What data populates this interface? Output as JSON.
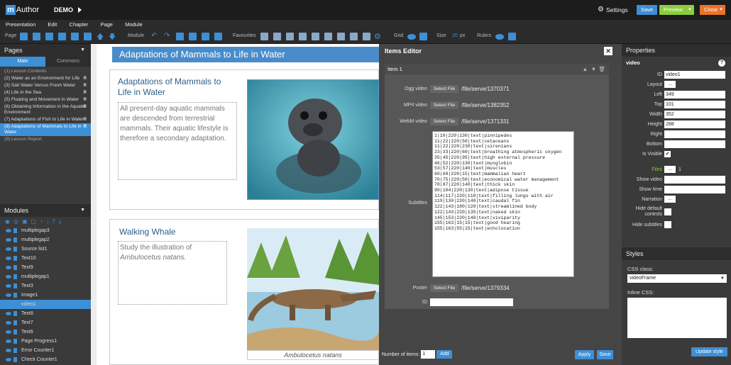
{
  "topbar": {
    "logo_m": "m",
    "logo_rest": "Author",
    "project": "DEMO",
    "settings": "Settings",
    "save": "Save",
    "preview": "Preview",
    "close": "Close"
  },
  "menu": [
    "Presentation",
    "Edit",
    "Chapter",
    "Page",
    "Module"
  ],
  "toolbar": {
    "page": "Page",
    "module": "Module",
    "favourites": "Favourites",
    "grid": "Grid",
    "size": "Size",
    "size_value": "20",
    "size_unit": "px",
    "rulers": "Rulers"
  },
  "pages": {
    "title": "Pages",
    "tab_main": "Main",
    "tab_commons": "Commons",
    "items": [
      {
        "label": "(1) Lesson Contents",
        "r": ""
      },
      {
        "label": "(2) Water as an Environment for Life",
        "r": "R"
      },
      {
        "label": "(3) Salt Water Versus Fresh Water",
        "r": "R"
      },
      {
        "label": "(4) Life in the Sea",
        "r": "R"
      },
      {
        "label": "(5) Floating and Movement in Water",
        "r": "R"
      },
      {
        "label": "(6) Obtaining Information in the Aquatic Environment",
        "r": "R"
      },
      {
        "label": "(7) Adaptations of Fish to Life in Water",
        "r": "R"
      },
      {
        "label": "(8) Adaptations of Mammals to Life in Water",
        "r": "R"
      },
      {
        "label": "(9) Lesson Report",
        "r": ""
      }
    ]
  },
  "modules": {
    "title": "Modules",
    "items": [
      "multiplegap3",
      "multiplegap2",
      "Source list1",
      "Text10",
      "Text9",
      "multiplegap1",
      "Text3",
      "Image1",
      "video1",
      "Text8",
      "Text7",
      "Text6",
      "Page Progress1",
      "Error Counter1",
      "Check Counter1"
    ]
  },
  "page": {
    "banner": "Adaptations of Mammals to Life in Water",
    "heading1": "Adaptations of Mammals to Life in Water",
    "text1": "All present-day aquatic mammals are descended from terrestrial mammals. Their aquatic lifestyle is therefore a secondary adaptation.",
    "heading2": "Walking Whale",
    "text2a": "Study the illustration of",
    "text2b": "Ambulocetus natans.",
    "caption": "Ambulocetus natans"
  },
  "items_editor": {
    "title": "Items Editor",
    "item": "Item 1",
    "ogg_label": "Ogg video",
    "ogg_path": "/file/serve/1370371",
    "mp4_label": "MP4 video",
    "mp4_path": "/file/serve/1382352",
    "webm_label": "WebM video",
    "webm_path": "/file/serve/1371331",
    "select_file": "Select File",
    "subtitles_label": "Subtitles",
    "subtitles": "1|10|220|130|text|pinnipedes\n11|22|220|50|text|cetaceans\n11|22|220|230|text|sirenians\n23|33|220|60|text|breathing atmospheric oxygen\n35|45|220|95|text|high external pressure\n46|52|220|130|text|myoglobin\n53|57|220|140|text|muscles\n60|68|220|15|text|mammalian heart\n70|75|220|50|text|economical water management\n78|87|220|140|text|thick skin\n90|104|220|130|text|adipose tissue\n114|117|220|110|text|filling lungs with air\n119|130|220|140|text|caudal fin\n122|143|180|120|text|streamlined body\n122|143|220|135|text|naked skin\n145|153|220|140|text|viviparity\n155|163|15|15|text|good hearing\n155|163|55|15|text|echolocation",
    "poster_label": "Poster",
    "poster_path": "/file/serve/1379334",
    "id_label": "ID",
    "id_value": "",
    "num_items_label": "Number of items:",
    "num_items": "1",
    "add": "Add",
    "apply": "Apply",
    "save": "Save"
  },
  "properties": {
    "title": "Properties",
    "section": "video",
    "rows": [
      {
        "k": "ID",
        "v": "video1"
      },
      {
        "k": "Layout",
        "v": "..."
      },
      {
        "k": "Left",
        "v": "349"
      },
      {
        "k": "Top",
        "v": "101"
      },
      {
        "k": "Width",
        "v": "352"
      },
      {
        "k": "Height",
        "v": "288"
      },
      {
        "k": "Right",
        "v": ""
      },
      {
        "k": "Bottom",
        "v": ""
      }
    ],
    "is_visible": "Is Visible",
    "files": "Files",
    "files_count": "1",
    "files_btn": "...",
    "show_video": "Show video",
    "show_time": "Show time",
    "narration": "Narration",
    "narration_btn": "...",
    "hide_default": "Hide default controls",
    "hide_subtitles": "Hide subtitles"
  },
  "styles": {
    "title": "Styles",
    "css_class_label": "CSS class:",
    "css_class": "videoFrame",
    "inline_css_label": "Inline CSS:",
    "update": "Update style"
  },
  "colors": {
    "accent": "#3d8fd6",
    "preview": "#8ccd3e",
    "close": "#e8742a",
    "selected": "#3d8fd6"
  }
}
